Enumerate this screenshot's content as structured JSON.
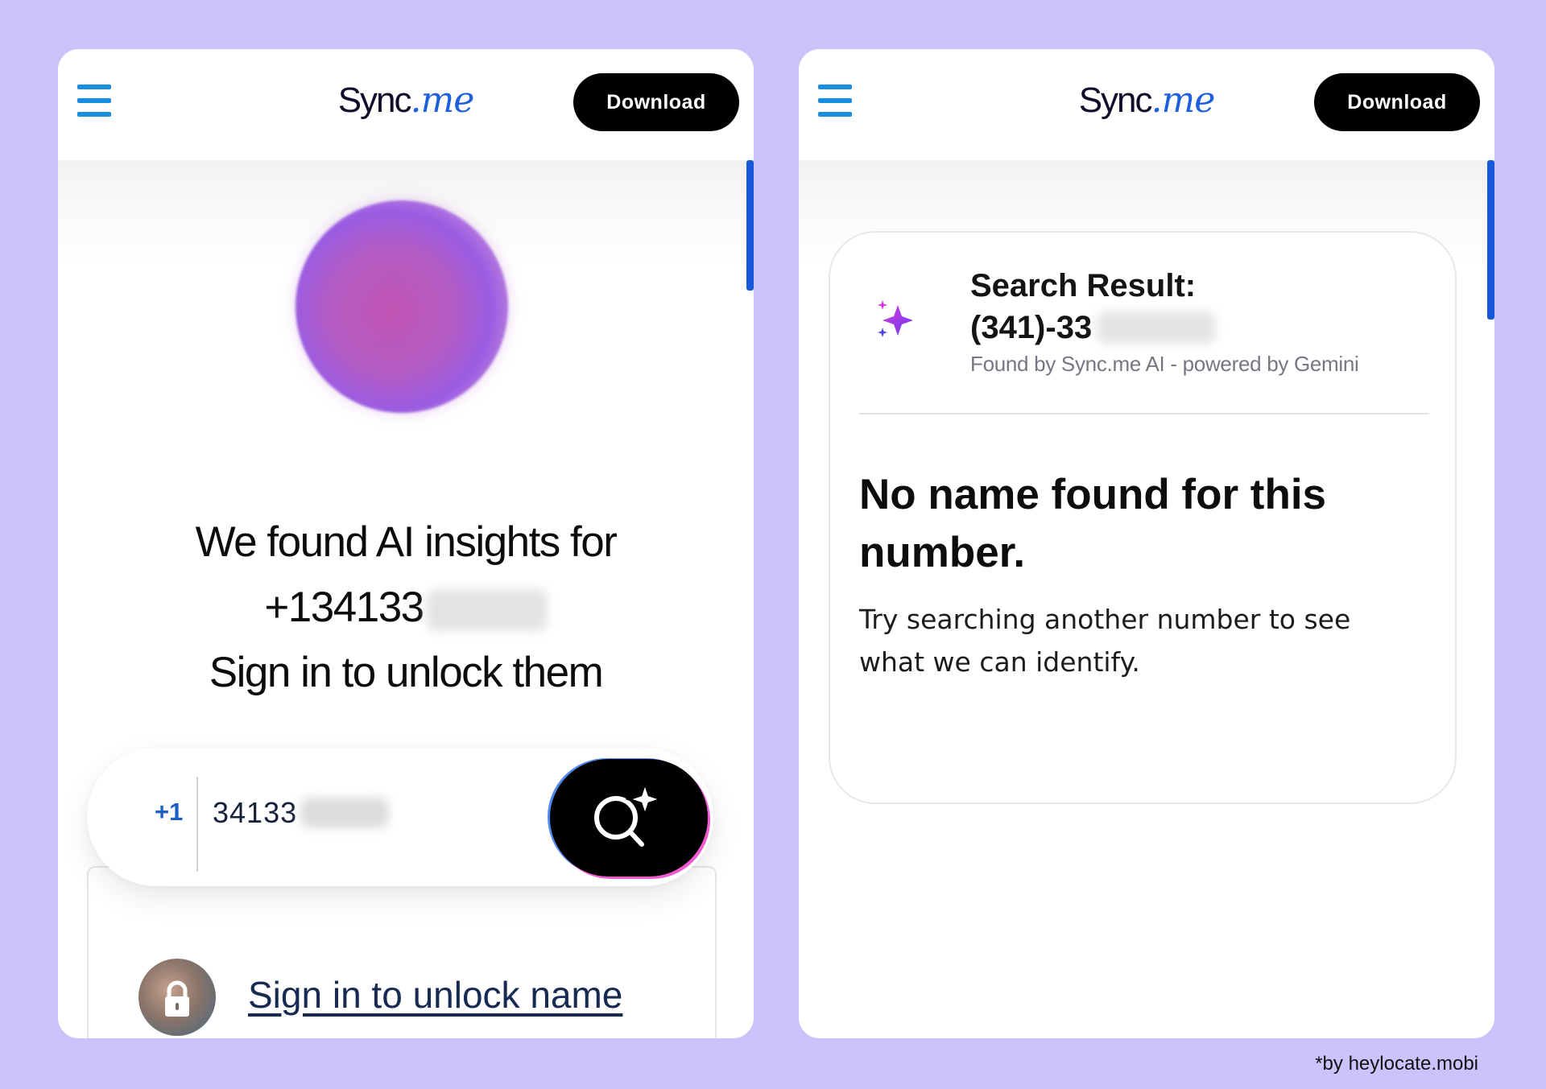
{
  "left_screen": {
    "header": {
      "logo_sync": "Sync",
      "logo_me": ".me",
      "download_label": "Download"
    },
    "headline": {
      "line1": "We found AI insights for",
      "line2_number": "+134133",
      "line3": "Sign in to unlock them"
    },
    "search": {
      "country_code": "+1",
      "phone_value": "34133"
    },
    "unlock_link": "Sign in to unlock name"
  },
  "right_screen": {
    "header": {
      "logo_sync": "Sync",
      "logo_me": ".me",
      "download_label": "Download"
    },
    "result": {
      "title": "Search Result:",
      "number": "(341)-33",
      "source": "Found by Sync.me AI - powered by Gemini",
      "no_name": "No name found for this number.",
      "hint": "Try searching another number to see what we can identify."
    }
  },
  "credit": "*by heylocate.mobi",
  "colors": {
    "background": "#cbc3fb",
    "brand_blue": "#1d5fdc",
    "hamburger_blue": "#1a8fe0",
    "sparkle_purple": "#8b3ff0",
    "sparkle_magenta": "#d63ad8"
  },
  "icons": [
    "hamburger-menu-icon",
    "ai-search-sparkle-icon",
    "lock-icon",
    "sparkle-icon"
  ]
}
